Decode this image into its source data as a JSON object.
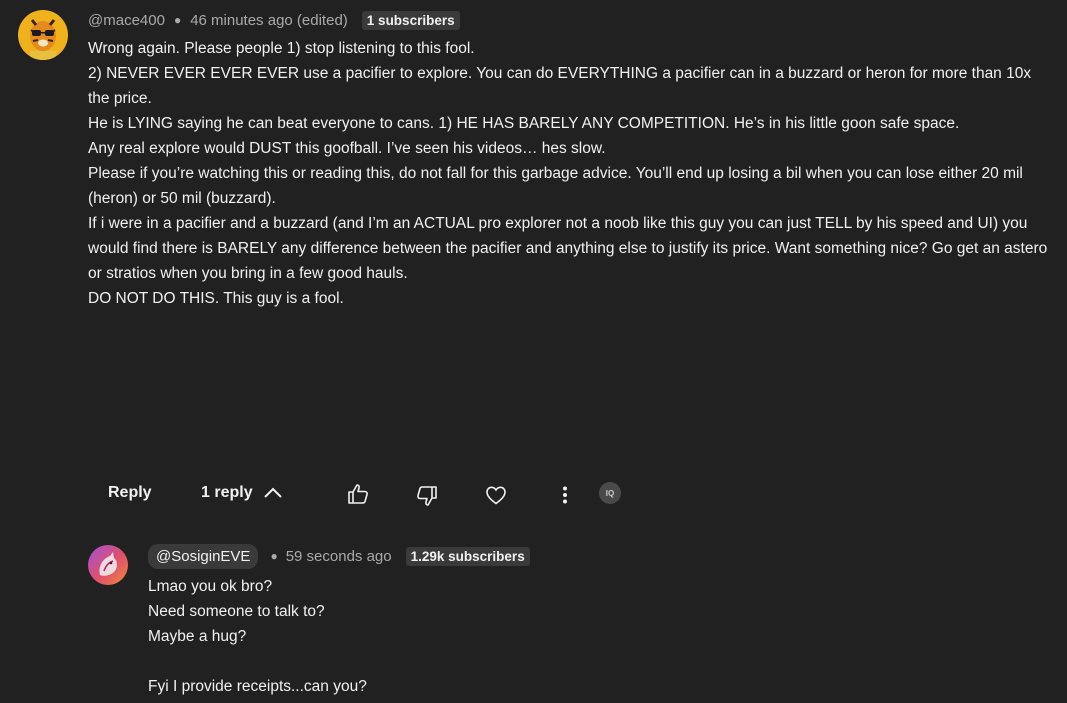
{
  "comment": {
    "handle": "@mace400",
    "time": "46 minutes ago (edited)",
    "badge": "1 subscribers",
    "paragraphs": [
      "Wrong again. Please people 1) stop listening to this fool.",
      "2) NEVER EVER EVER EVER use a pacifier to explore. You can do EVERYTHING a pacifier can in a buzzard or heron for more than 10x the price.",
      "He is LYING saying he can beat everyone to cans. 1) HE HAS BARELY ANY COMPETITION. He’s in his little goon safe space.",
      "Any real explore would DUST this goofball. I’ve seen his videos… hes slow.",
      "Please if you’re watching this or reading this, do not fall for this garbage advice. You’ll end up losing a bil when you can lose either 20 mil (heron) or 50 mil (buzzard).",
      "If i were in a pacifier and a buzzard (and I’m an ACTUAL pro explorer not a noob like this guy you can just TELL by his speed and UI) you would find there is BARELY any difference between the pacifier and anything else to justify its price. Want something nice? Go get an astero or stratios when you bring in a few good hauls.",
      "DO NOT DO THIS. This guy is a fool."
    ],
    "actions": {
      "reply_label": "Reply",
      "replies_label": "1 reply",
      "badge_icon_text": "IQ"
    }
  },
  "reply": {
    "handle": "@SosiginEVE",
    "time": "59 seconds ago",
    "badge": "1.29k subscribers",
    "lines": [
      "Lmao you ok bro?",
      "Need someone to talk to?",
      "Maybe a hug?",
      "",
      "Fyi I provide receipts...can you?"
    ]
  },
  "colors": {
    "background": "#212121",
    "text": "#f1f1f1",
    "muted": "#aaaaaa",
    "badge_bg": "#3a3a3a"
  }
}
